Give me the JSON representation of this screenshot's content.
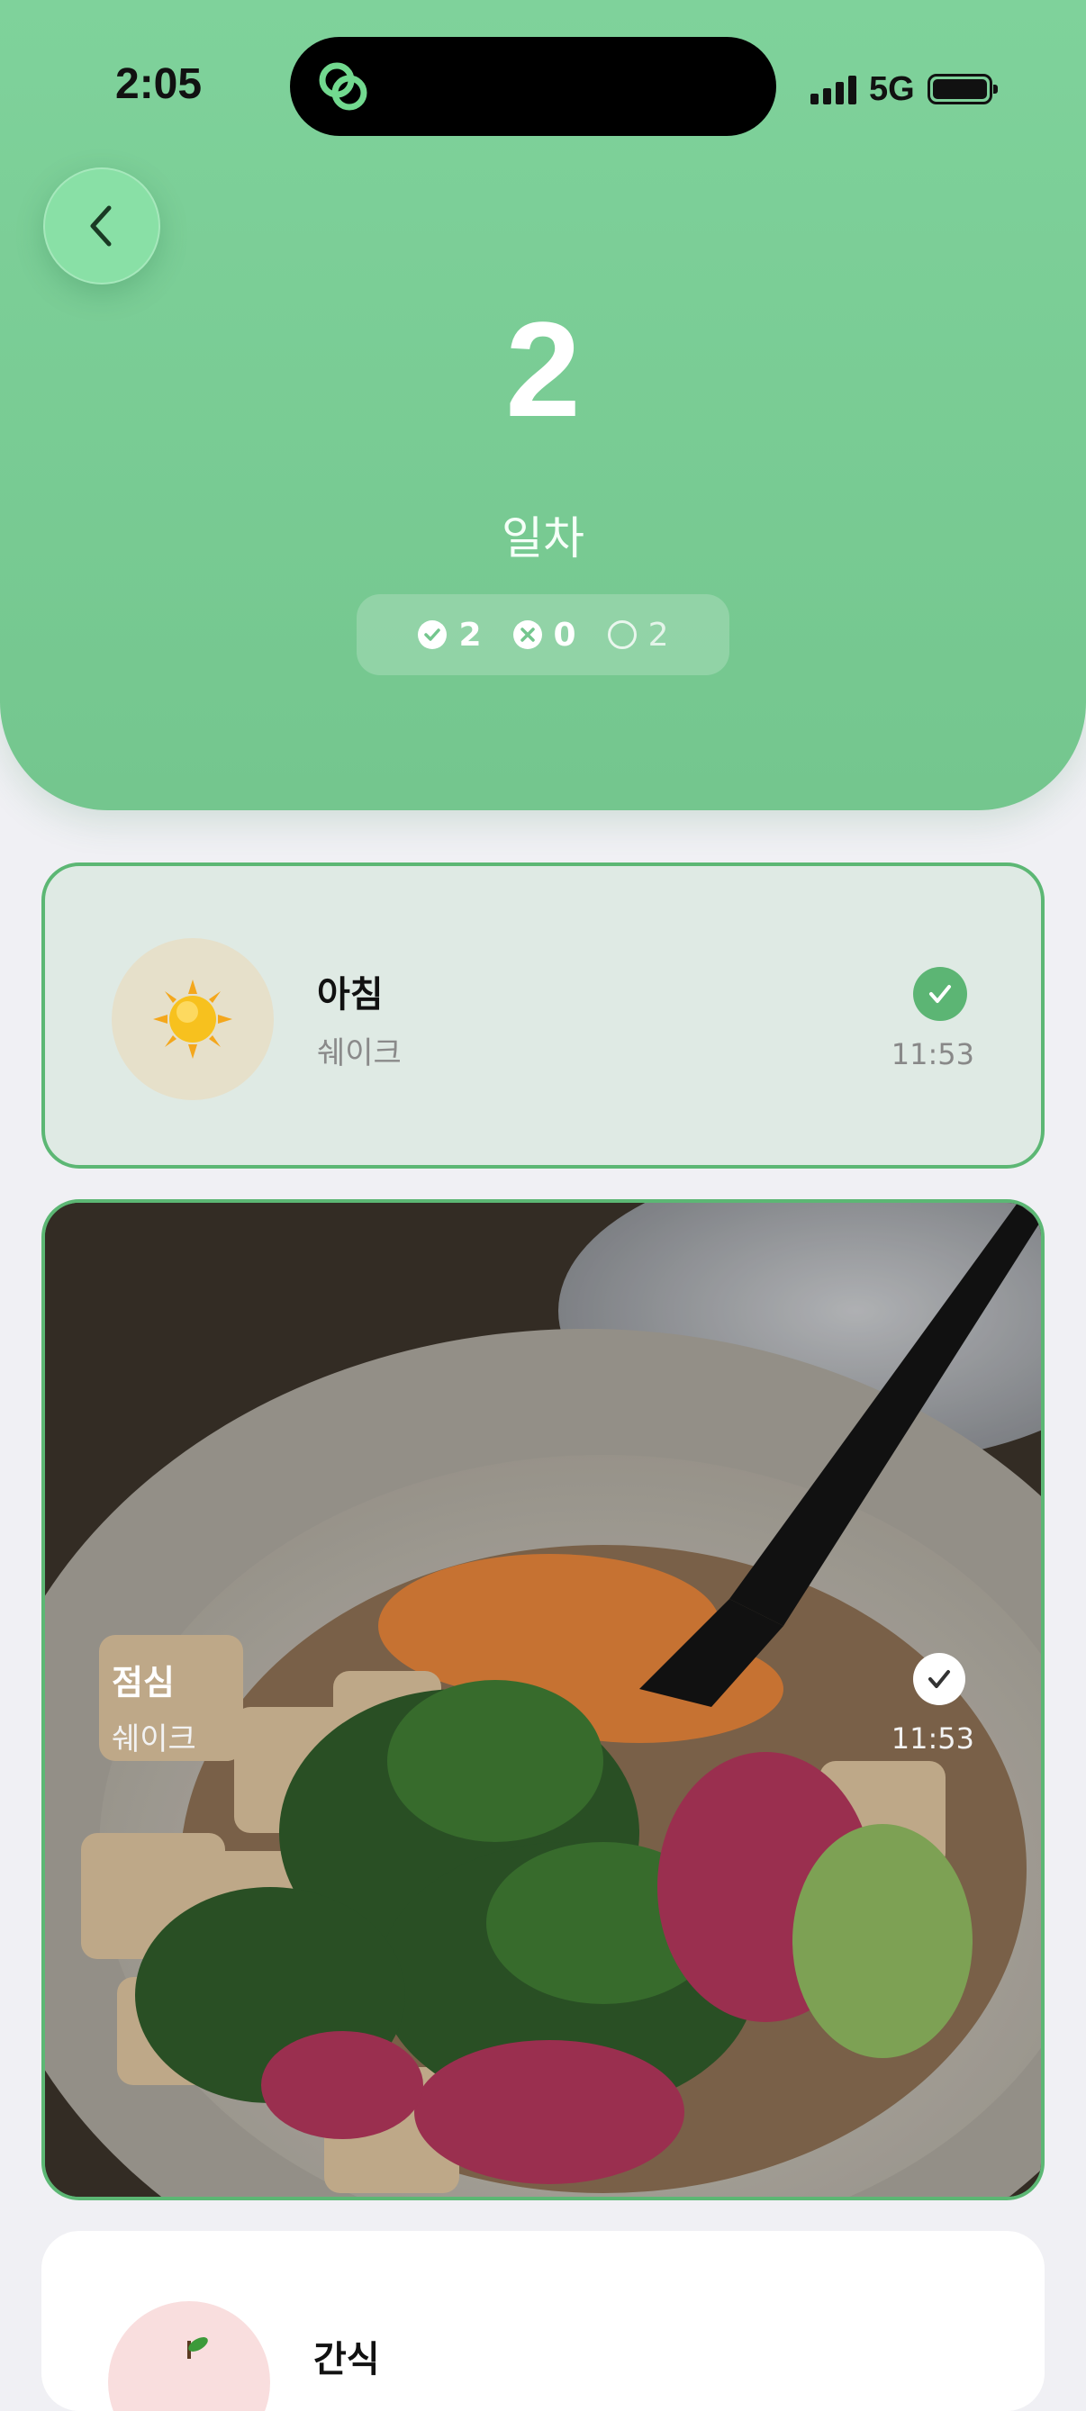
{
  "status_bar": {
    "time": "2:05",
    "network": "5G"
  },
  "header": {
    "day_number": "2",
    "day_label": "일차",
    "stats": {
      "completed": "2",
      "skipped": "0",
      "pending": "2"
    }
  },
  "meals": [
    {
      "title": "아침",
      "subtitle": "쉐이크",
      "time": "11:53",
      "icon": "sun-icon",
      "status": "completed"
    },
    {
      "title": "점심",
      "subtitle": "쉐이크",
      "time": "11:53",
      "icon": "meal-photo",
      "status": "completed"
    },
    {
      "title": "간식",
      "icon": "apple-icon"
    }
  ],
  "colors": {
    "header_green": "#7fd29b",
    "accent_green": "#5cb574",
    "card_border": "#5cb774",
    "background": "#f0f0f4"
  }
}
